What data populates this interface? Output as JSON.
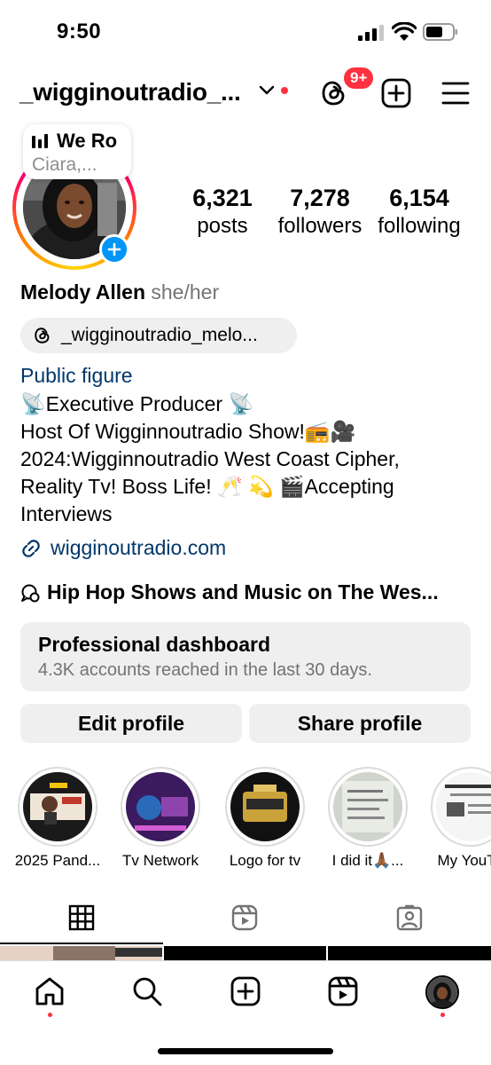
{
  "status_bar": {
    "time": "9:50"
  },
  "header": {
    "username": "_wigginoutradio_...",
    "notification_badge": "9+",
    "accent_color": "#ff3040"
  },
  "note": {
    "title": "We Ro",
    "subtitle": "Ciara,..."
  },
  "stats": {
    "posts_count": "6,321",
    "posts_label": "posts",
    "followers_count": "7,278",
    "followers_label": "followers",
    "following_count": "6,154",
    "following_label": "following"
  },
  "bio": {
    "name": "Melody Allen",
    "pronouns": "she/her",
    "threads_handle": "_wigginoutradio_melo...",
    "category": "Public figure",
    "lines": [
      "📡Executive Producer 📡",
      "Host Of Wigginnoutradio Show!📻🎥",
      "2024:Wigginnoutradio West Coast Cipher,",
      "Reality Tv! Boss Life! 🥂 💫 🎬Accepting",
      "Interviews"
    ],
    "link": "wigginoutradio.com",
    "channel": "Hip Hop Shows and Music on The Wes..."
  },
  "dashboard": {
    "title": "Professional dashboard",
    "subtitle": "4.3K accounts reached in the last 30 days."
  },
  "buttons": {
    "edit": "Edit profile",
    "share": "Share profile"
  },
  "highlights": [
    {
      "label": "2025 Pand..."
    },
    {
      "label": "Tv Network"
    },
    {
      "label": "Logo for tv"
    },
    {
      "label": "I did it🙏🏾..."
    },
    {
      "label": "My YouTu"
    }
  ],
  "tabs": [
    "grid-icon",
    "reels-icon",
    "tagged-icon"
  ],
  "bottom_nav": [
    "home-icon",
    "search-icon",
    "create-icon",
    "reels-icon",
    "profile-avatar"
  ]
}
